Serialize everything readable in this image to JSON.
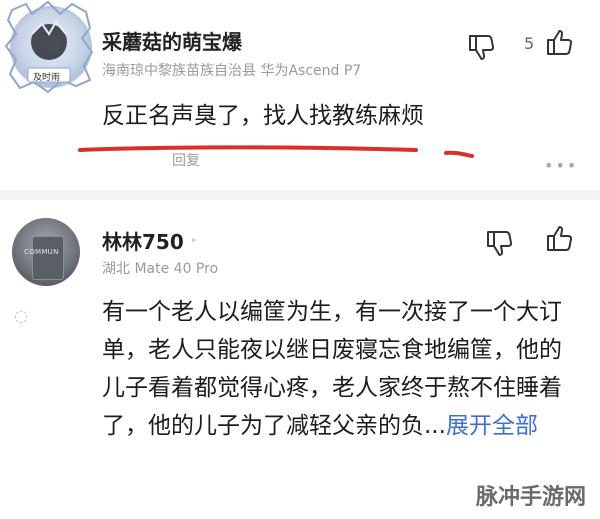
{
  "comment1": {
    "username": "采蘑菇的萌宝爆",
    "meta": "海南琼中黎族苗族自治县  华为Ascend P7",
    "text": "反正名声臭了，找人找教练麻烦",
    "reply_label": "回复",
    "like_count": "5",
    "avatar_caption": "及时雨",
    "more": "•••"
  },
  "comment2": {
    "username": "林林750",
    "meta": "湖北  Mate 40 Pro",
    "text": "有一个老人以编筐为生，有一次接了一个大订单，老人只能夜以继日废寝忘食地编筐，他的儿子看着都觉得心疼，老人家终于熬不住睡着了，他的儿子为了减轻父亲的负...",
    "expand": "展开全部",
    "avatar_label": "COMMUN"
  },
  "watermark": "脉冲手游网",
  "colors": {
    "underline": "#d9302c",
    "link": "#3f6fd1",
    "meta": "#9a9a9a"
  },
  "icons": [
    "thumbs-down-icon",
    "thumbs-up-icon",
    "more-icon"
  ]
}
